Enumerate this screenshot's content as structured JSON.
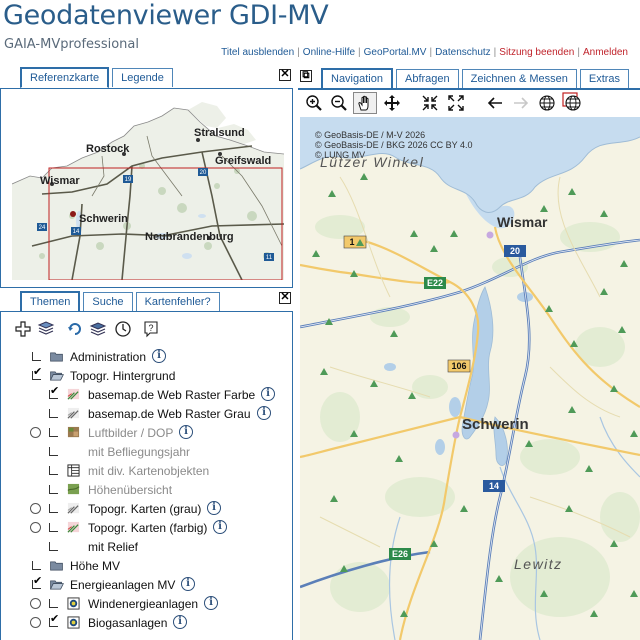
{
  "header": {
    "title": "Geodatenviewer GDI-MV",
    "subtitle": "GAIA-MVprofessional",
    "links": [
      {
        "label": "Titel ausblenden",
        "red": false
      },
      {
        "label": "Online-Hilfe",
        "red": false
      },
      {
        "label": "GeoPortal.MV",
        "red": false
      },
      {
        "label": "Datenschutz",
        "red": false
      },
      {
        "label": "Sitzung beenden",
        "red": true
      },
      {
        "label": "Anmelden",
        "red": true
      }
    ],
    "separator": "|"
  },
  "left_top_panel": {
    "tabs": [
      "Referenzkarte",
      "Legende"
    ],
    "active_tab": "Referenzkarte",
    "close_label": "✕"
  },
  "reference_map": {
    "cities": [
      "Stralsund",
      "Rostock",
      "Greifswald",
      "Wismar",
      "Schwerin",
      "Neubrandenburg"
    ],
    "road_shields": [
      "19",
      "20",
      "24",
      "14",
      "11"
    ]
  },
  "left_bottom_panel": {
    "tabs": [
      "Themen",
      "Suche",
      "Kartenfehler?"
    ],
    "active_tab": "Themen",
    "close_label": "✕",
    "toolbar_icons": [
      "add-icon",
      "layers-icon",
      "refresh-icon",
      "layers-stack-icon",
      "clock-icon",
      "help-icon"
    ]
  },
  "theme_tree": [
    {
      "label": "Administration",
      "control": "check",
      "checked": false,
      "icon": "folder",
      "info": true,
      "indent": 0,
      "dim": false
    },
    {
      "label": "Topogr. Hintergrund",
      "control": "check",
      "checked": true,
      "icon": "folder-open",
      "info": false,
      "indent": 0,
      "dim": false
    },
    {
      "label": "basemap.de Web Raster Farbe",
      "control": "check",
      "checked": true,
      "icon": "raster-color",
      "info": true,
      "indent": 1,
      "dim": false
    },
    {
      "label": "basemap.de Web Raster Grau",
      "control": "check",
      "checked": false,
      "icon": "raster-gray",
      "info": true,
      "indent": 1,
      "dim": false
    },
    {
      "label": "Luftbilder / DOP",
      "control": "radio-check",
      "checked": false,
      "icon": "photo",
      "info": true,
      "indent": 1,
      "dim": true
    },
    {
      "label": "mit Befliegungsjahr",
      "control": "check",
      "checked": false,
      "icon": "none",
      "info": false,
      "indent": 1,
      "dim": true
    },
    {
      "label": "mit div. Kartenobjekten",
      "control": "check",
      "checked": false,
      "icon": "table",
      "info": false,
      "indent": 1,
      "dim": true
    },
    {
      "label": "Höhenübersicht",
      "control": "check",
      "checked": false,
      "icon": "relief",
      "info": false,
      "indent": 1,
      "dim": true
    },
    {
      "label": "Topogr. Karten (grau)",
      "control": "radio-check",
      "checked": false,
      "icon": "raster-gray",
      "info": true,
      "indent": 1,
      "dim": false
    },
    {
      "label": "Topogr. Karten (farbig)",
      "control": "radio-check",
      "checked": false,
      "icon": "raster-color",
      "info": true,
      "indent": 1,
      "dim": false
    },
    {
      "label": "mit Relief",
      "control": "check",
      "checked": false,
      "icon": "none",
      "info": false,
      "indent": 1,
      "dim": false
    },
    {
      "label": "Höhe MV",
      "control": "check",
      "checked": false,
      "icon": "folder",
      "info": false,
      "indent": 0,
      "dim": false
    },
    {
      "label": "Energieanlagen MV",
      "control": "check",
      "checked": true,
      "icon": "folder-open",
      "info": true,
      "indent": 0,
      "dim": false
    },
    {
      "label": "Windenergieanlagen",
      "control": "radio-check",
      "checked": false,
      "icon": "point-layer",
      "info": true,
      "indent": 1,
      "dim": false
    },
    {
      "label": "Biogasanlagen",
      "control": "radio-check",
      "checked": true,
      "icon": "point-layer",
      "info": true,
      "indent": 1,
      "dim": false
    }
  ],
  "right_panel": {
    "tabs": [
      "Navigation",
      "Abfragen",
      "Zeichnen & Messen",
      "Extras"
    ],
    "active_tab": "Navigation",
    "detach_label": "⧉",
    "toolbar_icons": [
      "zoom-in-icon",
      "zoom-out-icon",
      "pan-hand-icon",
      "move-arrows-icon",
      "zoom-extent-icon",
      "fullscreen-icon",
      "back-arrow-icon",
      "forward-arrow-icon",
      "globe-icon",
      "globe-select-icon"
    ]
  },
  "main_map": {
    "attribution": [
      "© GeoBasis-DE / M-V 2026",
      "© GeoBasis-DE / BKG 2026 CC BY 4.0",
      "© LUNG MV"
    ],
    "places": [
      "Wismar",
      "Schwerin",
      "Lewitz",
      "Lützer Winkel"
    ],
    "road_shields": [
      "20",
      "E22",
      "106",
      "14",
      "E26",
      "1"
    ]
  }
}
